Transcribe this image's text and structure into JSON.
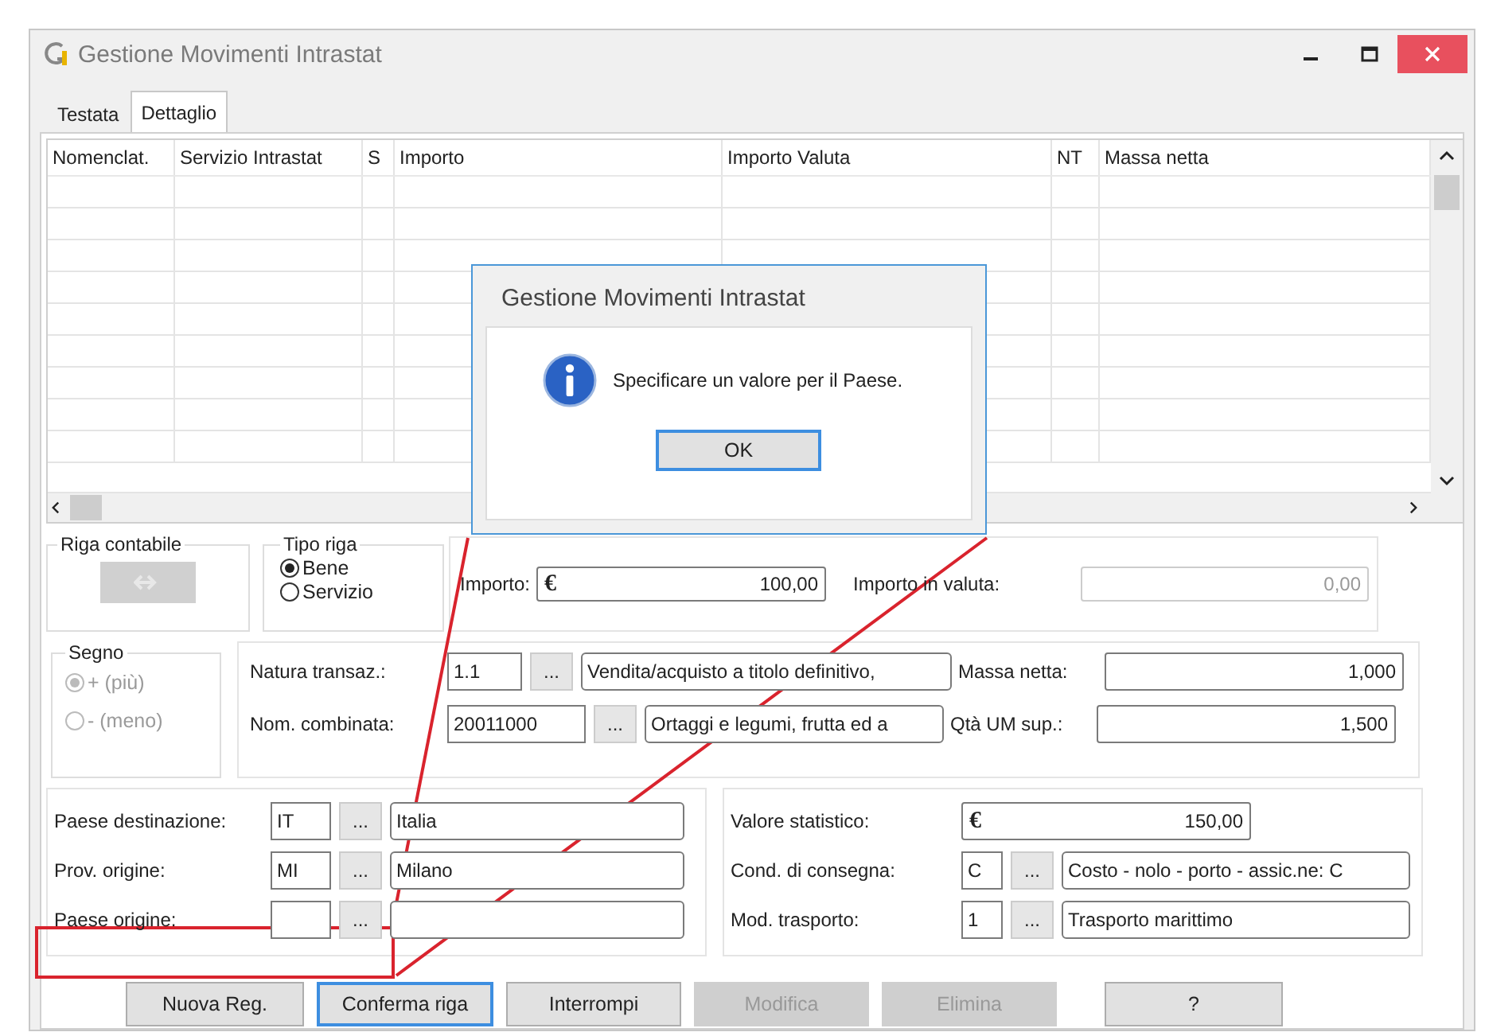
{
  "window": {
    "title": "Gestione Movimenti Intrastat"
  },
  "tabs": [
    {
      "label": "Testata",
      "selected": false
    },
    {
      "label": "Dettaglio",
      "selected": true
    }
  ],
  "table": {
    "columns": [
      "Nomenclat.",
      "Servizio Intrastat",
      "S",
      "Importo",
      "Importo Valuta",
      "NT",
      "Massa netta"
    ]
  },
  "riga_contabile": {
    "label": "Riga contabile",
    "button_disabled": true
  },
  "tipo_riga": {
    "label": "Tipo riga",
    "disabled": false,
    "options": [
      {
        "label": "Bene",
        "selected": true
      },
      {
        "label": "Servizio",
        "selected": false
      }
    ]
  },
  "importo": {
    "label": "Importo:",
    "currency": "€",
    "value": "100,00"
  },
  "importo_valuta": {
    "label": "Importo in valuta:",
    "value": "0,00",
    "disabled": true
  },
  "segno": {
    "label": "Segno",
    "disabled": true,
    "options": [
      {
        "label": "+ (più)",
        "selected": true
      },
      {
        "label": "- (meno)",
        "selected": false
      }
    ]
  },
  "classificazione": [
    {
      "label": "Natura transaz.:",
      "code": "1.1",
      "button": "...",
      "description": "Vendita/acquisto a titolo definitivo,",
      "measure_label": "Massa netta:",
      "measure_value": "1,000"
    },
    {
      "label": "Nom. combinata:",
      "code": "20011000",
      "button": "...",
      "description": "Ortaggi e legumi, frutta ed a",
      "measure_label": "Qtà UM sup.:",
      "measure_value": "1,500"
    }
  ],
  "origine": [
    {
      "label": "Paese destinazione:",
      "code": "IT",
      "button": "...",
      "description": "Italia"
    },
    {
      "label": "Prov. origine:",
      "code": "MI",
      "button": "...",
      "description": "Milano"
    },
    {
      "label": "Paese origine:",
      "button": "..."
    }
  ],
  "trasporto": {
    "valore_label": "Valore statistico:",
    "currency": "€",
    "valore": "150,00",
    "rows": [
      {
        "label": "Cond. di consegna:",
        "code": "C",
        "button": "...",
        "description": "Costo - nolo - porto - assic.ne: C"
      },
      {
        "label": "Mod. trasporto:",
        "code": "1",
        "button": "...",
        "description": "Trasporto marittimo"
      }
    ]
  },
  "buttons": [
    {
      "label": "Nuova Reg.",
      "disabled": false,
      "focused": false
    },
    {
      "label": "Conferma riga",
      "disabled": false,
      "focused": true
    },
    {
      "label": "Interrompi",
      "disabled": false,
      "focused": false
    },
    {
      "label": "Modifica",
      "disabled": true,
      "focused": false
    },
    {
      "label": "Elimina",
      "disabled": true,
      "focused": false
    },
    {
      "label": "?",
      "disabled": false,
      "focused": false
    }
  ],
  "dialog": {
    "title": "Gestione Movimenti Intrastat",
    "message": "Specificare un valore per il Paese.",
    "button": "OK"
  }
}
